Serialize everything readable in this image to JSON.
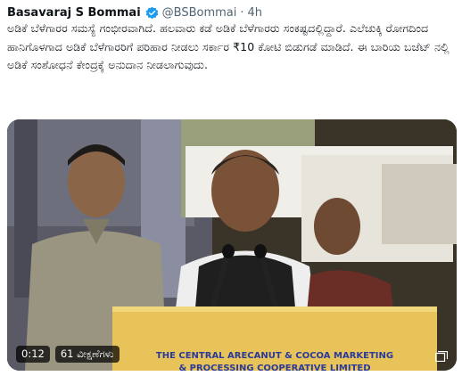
{
  "tweet": {
    "author_name": "Basavaraj S Bommai",
    "handle": "@BSBommai",
    "separator": "·",
    "time": "4h",
    "text": "ಅಡಿಕೆ ಬೆಳೆಗಾರರ ಸಮಸ್ಯೆ ಗಂಭೀರವಾಗಿದೆ. ಹಲವಾರು ಕಡೆ ಅಡಿಕೆ ಬೆಳೆಗಾರರು ಸಂಕಷ್ಟದಲ್ಲಿದ್ದಾರೆ. ಎಲೆಚುಕ್ಕಿ ರೋಗದಿಂದ ಹಾನಿಗೊಳಗಾದ ಅಡಿಕೆ ಬೆಳೆಗಾರರಿಗೆ ಪರಿಹಾರ ನೀಡಲು ಸರ್ಕಾರ ₹10 ಕೋಟಿ ಬಿಡುಗಡೆ ಮಾಡಿದೆ. ಈ ಬಾರಿಯ ಬಜೆಟ್ ನಲ್ಲಿ ಅಡಿಕೆ ಸಂಶೋಧನೆ ಕೇಂದ್ರಕ್ಕೆ ಅನುದಾನ ನೀಡಲಾಗುವುದು."
  },
  "media": {
    "banner_line1": "THE CENTRAL ARECANUT & COCOA MARKETING",
    "banner_line2": "& PROCESSING COOPERATIVE LIMITED",
    "timestamp": "0:12",
    "views": "61 ವೀಕ್ಷಣೆಗಳು",
    "icons": [
      "verified-badge-icon",
      "media-gallery-icon"
    ]
  },
  "colors": {
    "verified": "#1d9bf0",
    "muted_text": "#536471",
    "podium": "#e8c35a"
  }
}
